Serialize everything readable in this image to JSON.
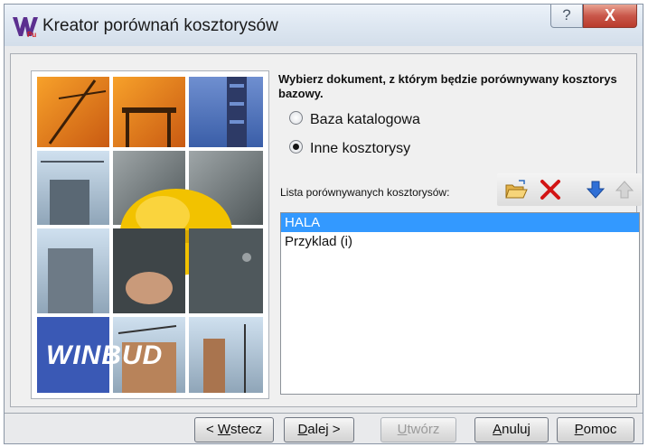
{
  "window": {
    "title": "Kreator porównań kosztorysów",
    "help_label": "?",
    "close_label": "X"
  },
  "image_panel": {
    "logo_text": "WINBUD"
  },
  "instruction": "Wybierz dokument, z którym będzie porównywany kosztorys bazowy.",
  "options": [
    {
      "label": "Baza katalogowa",
      "selected": false
    },
    {
      "label": "Inne kosztorysy",
      "selected": true
    }
  ],
  "list": {
    "label": "Lista porównywanych kosztorysów:",
    "items": [
      {
        "text": "HALA",
        "selected": true
      },
      {
        "text": "Przyklad (i)",
        "selected": false
      }
    ]
  },
  "toolbar": {
    "icons": [
      "open-folder-icon",
      "delete-icon",
      "move-down-icon",
      "move-up-icon"
    ]
  },
  "buttons": {
    "back": {
      "prefix": "< ",
      "hotkey": "W",
      "rest": "stecz"
    },
    "next": {
      "hotkey": "D",
      "rest": "alej >"
    },
    "create": {
      "hotkey": "U",
      "rest": "twórz",
      "enabled": false
    },
    "cancel": {
      "hotkey": "A",
      "rest": "nuluj"
    },
    "help": {
      "hotkey": "P",
      "rest": "omoc"
    }
  },
  "colors": {
    "selection": "#3399ff",
    "close_button": "#c9574a",
    "delete_icon": "#d21414",
    "arrow_down": "#2f6fd6",
    "arrow_up": "#b8b8b8"
  }
}
